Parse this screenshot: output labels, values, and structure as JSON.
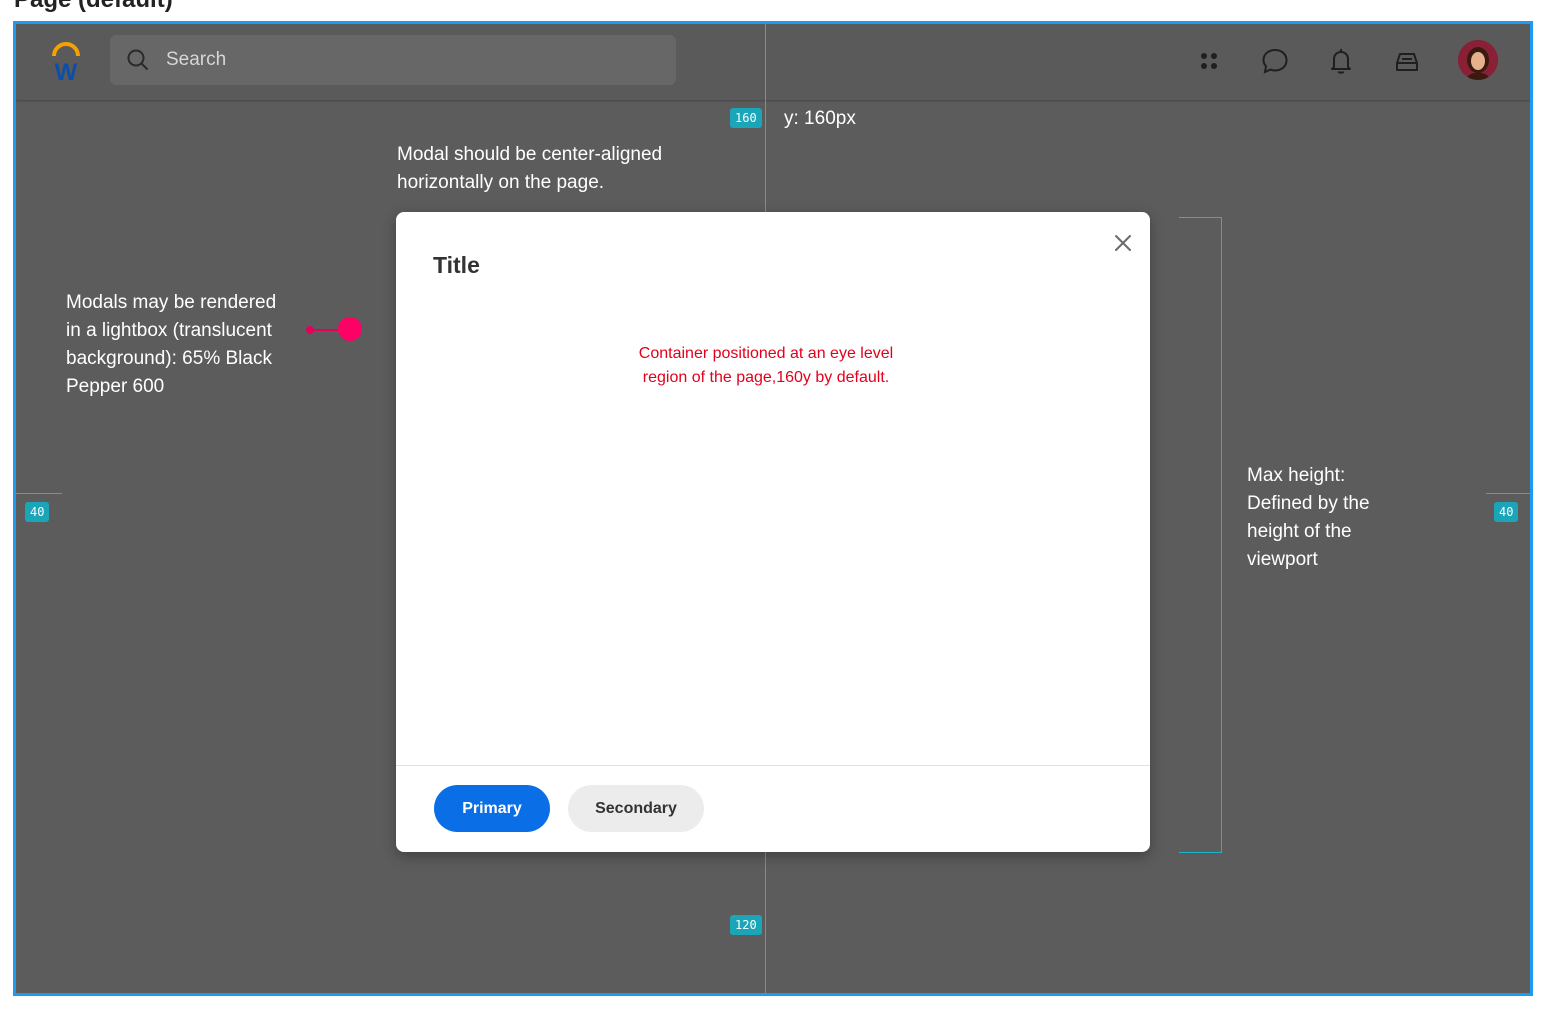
{
  "page": {
    "heading": "Page (default)"
  },
  "header": {
    "logo_letter": "W",
    "search": {
      "placeholder": "Search"
    },
    "icons": [
      "apps-icon",
      "chat-icon",
      "bell-icon",
      "inbox-icon"
    ]
  },
  "annotations": {
    "top_badge": "160",
    "y_label": "y: 160px",
    "center_note_line1": "Modal should be center-aligned",
    "center_note_line2": "horizontally on the page.",
    "lightbox_line1": "Modals may be rendered",
    "lightbox_line2": "in a lightbox (translucent",
    "lightbox_line3": "background): 65% Black",
    "lightbox_line4": "Pepper 600",
    "left_badge": "40",
    "right_badge": "40",
    "bottom_badge": "120",
    "maxheight_line1": "Max height:",
    "maxheight_line2": "Defined by the",
    "maxheight_line3": "height of the",
    "maxheight_line4": "viewport"
  },
  "modal": {
    "title": "Title",
    "note_line1": "Container positioned at an eye level",
    "note_line2": "region of the page,160y by default.",
    "primary_label": "Primary",
    "secondary_label": "Secondary"
  },
  "colors": {
    "frame_border": "#1e9bf0",
    "overlay": "#5c5c5c",
    "guide": "#1eb4cc",
    "pin": "#ff0066",
    "primary": "#0a6fe6",
    "note_red": "#e3001b"
  }
}
